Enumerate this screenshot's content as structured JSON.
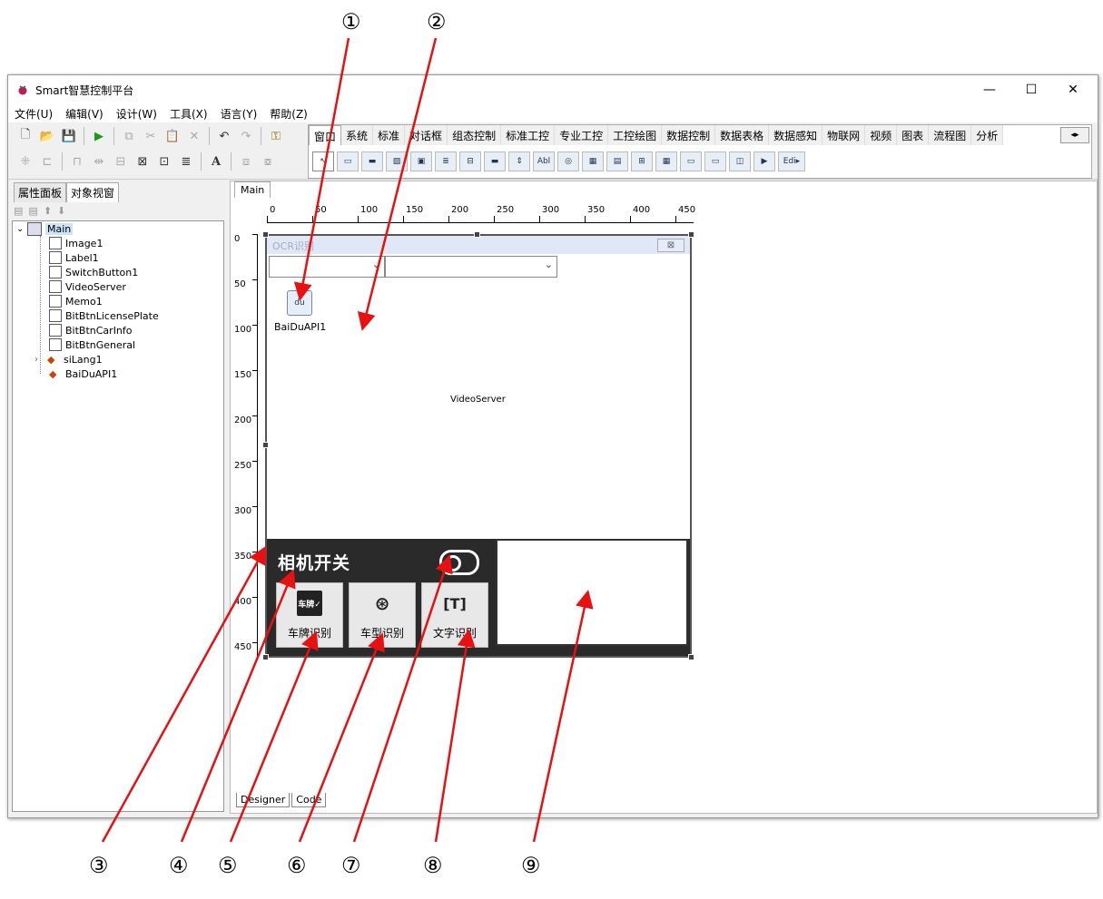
{
  "window": {
    "title": "Smart智慧控制平台",
    "minimize": "—",
    "maximize": "☐",
    "close": "✕"
  },
  "menu": [
    "文件(U)",
    "编辑(V)",
    "设计(W)",
    "工具(X)",
    "语言(Y)",
    "帮助(Z)"
  ],
  "palette": {
    "tabs": [
      "窗口",
      "系统",
      "标准",
      "对话框",
      "组态控制",
      "标准工控",
      "专业工控",
      "工控绘图",
      "数据控制",
      "数据表格",
      "数据感知",
      "物联网",
      "视频",
      "图表",
      "流程图",
      "分析"
    ],
    "active_tab": "窗口",
    "scroll": "◂▸",
    "icons": [
      "▭",
      "▬",
      "▨",
      "▣",
      "≣",
      "⊟",
      "▬",
      "⇕",
      "Abl",
      "◎",
      "▦",
      "▤",
      "⊞",
      "▦",
      "▭",
      "▭",
      "◫",
      "▶",
      "Edi▸"
    ]
  },
  "left_panel": {
    "tabs": [
      "属性面板",
      "对象视窗"
    ],
    "active_tab": "对象视窗",
    "toolbar": [
      "▤",
      "▤",
      "⬆",
      "⬇"
    ],
    "tree": {
      "root": "Main",
      "expander": "⌄",
      "items": [
        {
          "label": "Image1",
          "kind": "form"
        },
        {
          "label": "Label1",
          "kind": "form"
        },
        {
          "label": "SwitchButton1",
          "kind": "form"
        },
        {
          "label": "VideoServer",
          "kind": "form"
        },
        {
          "label": "Memo1",
          "kind": "form"
        },
        {
          "label": "BitBtnLicensePlate",
          "kind": "form"
        },
        {
          "label": "BitBtnCarInfo",
          "kind": "form"
        },
        {
          "label": "BitBtnGeneral",
          "kind": "form"
        },
        {
          "label": "siLang1",
          "kind": "comp",
          "expander": "›"
        },
        {
          "label": "BaiDuAPI1",
          "kind": "comp"
        }
      ]
    }
  },
  "designer": {
    "tab": "Main",
    "bottom_tabs": [
      "Designer",
      "Code"
    ],
    "hruler": [
      "0",
      "50",
      "100",
      "150",
      "200",
      "250",
      "300",
      "350",
      "400",
      "450"
    ],
    "vruler": [
      "0",
      "50",
      "100",
      "150",
      "200",
      "250",
      "300",
      "350",
      "400",
      "450"
    ],
    "form": {
      "title": "OCR识别",
      "close": "⊠",
      "combo_arrow": "⌄",
      "baidu_icon": "du",
      "baidu_label": "BaiDuAPI1",
      "video_label": "VideoServer",
      "camera_label": "相机开关",
      "buttons": [
        {
          "label": "车牌识别",
          "icon": "车牌✓"
        },
        {
          "label": "车型识别",
          "icon": "⊛"
        },
        {
          "label": "文字识别",
          "icon": "[T]"
        }
      ]
    }
  },
  "callouts": [
    "①",
    "②",
    "③",
    "④",
    "⑤",
    "⑥",
    "⑦",
    "⑧",
    "⑨"
  ]
}
